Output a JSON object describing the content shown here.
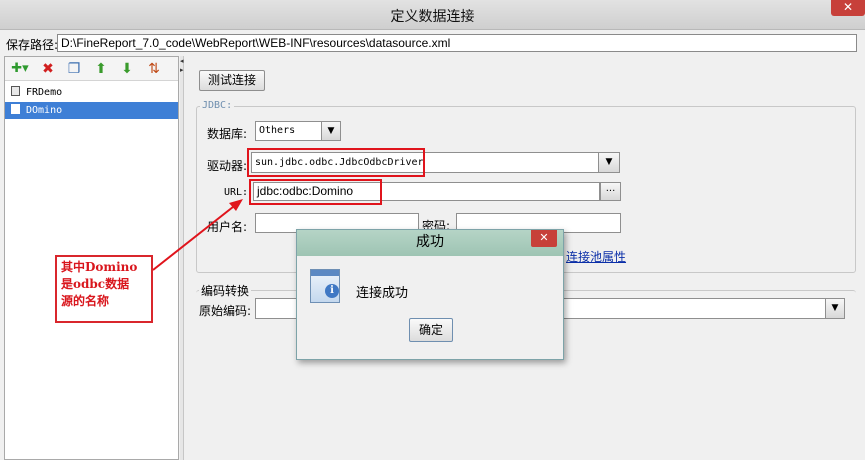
{
  "window": {
    "title": "定义数据连接",
    "close_glyph": "✕"
  },
  "path": {
    "label": "保存路径:",
    "value": "D:\\FineReport_7.0_code\\WebReport\\WEB-INF\\resources\\datasource.xml"
  },
  "toolbar": {
    "icons": [
      "add-icon",
      "delete-icon",
      "copy-icon",
      "move-up-icon",
      "move-down-icon",
      "sort-icon"
    ],
    "add_glyph": "✚▾",
    "delete_glyph": "✖",
    "copy_glyph": "❐",
    "up_glyph": "⬆",
    "down_glyph": "⬇",
    "sort_glyph": "⇅"
  },
  "connections": [
    {
      "name": "FRDemo",
      "selected": false
    },
    {
      "name": "DOmino",
      "selected": true
    }
  ],
  "form": {
    "test_button": "测试连接",
    "jdbc_legend": "JDBC:",
    "db_label": "数据库:",
    "db_value": "Others",
    "driver_label": "驱动器:",
    "driver_value": "sun.jdbc.odbc.JdbcOdbcDriver",
    "url_label": "URL:",
    "url_value": "jdbc:odbc:Domino",
    "user_label": "用户名:",
    "user_value": "",
    "password_label": "密码:",
    "password_value": "",
    "pool_link": "连接池属性",
    "encoding_legend": "编码转换",
    "orig_encoding_label": "原始编码:",
    "browse_glyph": "..."
  },
  "callout": {
    "lines": [
      "其中Domino",
      "是odbc数据",
      "源的名称"
    ],
    "color": "#d9161d"
  },
  "dialog": {
    "title": "成功",
    "message": "连接成功",
    "ok": "确定",
    "close_glyph": "✕"
  },
  "colors": {
    "selection": "#3e7fd6",
    "highlight": "#e0141c",
    "dialog_title": "#a9cdbd",
    "link": "#0b2fa8"
  }
}
